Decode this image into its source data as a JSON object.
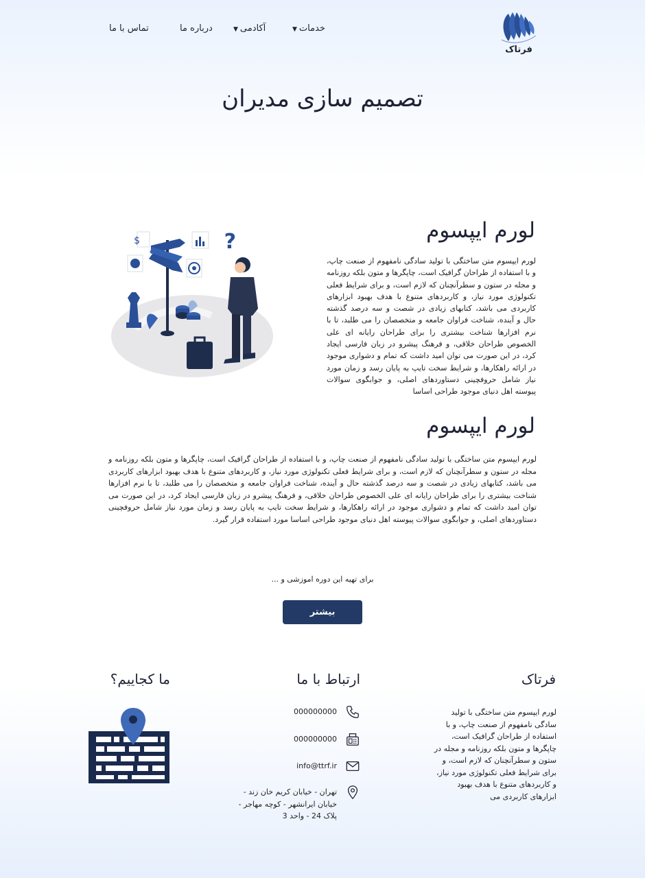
{
  "header": {
    "logo_text": "فرتاک",
    "nav": {
      "services": "خدمات",
      "academy": "آکادمی",
      "about": "درباره ما",
      "contact": "تماس با ما"
    }
  },
  "page_title": "تصمیم سازی مدیران",
  "section1": {
    "title": "لورم ایپسوم",
    "text": "لورم ایپسوم متن ساختگی با تولید سادگی نامفهوم از صنعت چاپ، و با استفاده از طراحان گرافیک است، چاپگرها و متون بلکه روزنامه و مجله در ستون و سطرآنچنان که لازم است، و برای شرایط فعلی تکنولوژی مورد نیاز، و کاربردهای متنوع با هدف بهبود ابزارهای کاربردی می باشد، کتابهای زیادی در شصت و سه درصد گذشته حال و آینده، شناخت فراوان جامعه و متخصصان را می طلبد، تا با نرم افزارها شناخت بیشتری را برای طراحان رایانه ای علی الخصوص طراحان خلاقی، و فرهنگ پیشرو در زبان فارسی ایجاد کرد، در این صورت می توان امید داشت که تمام و دشواری موجود در ارائه راهکارها، و شرایط سخت تایپ به پایان رسد و زمان مورد نیاز شامل حروفچینی دستاوردهای اصلی، و جوابگوی سوالات پیوسته اهل دنیای موجود طراحی اساسا"
  },
  "section2": {
    "title": "لورم ایپسوم",
    "text": "لورم ایپسوم متن ساختگی با تولید سادگی نامفهوم از صنعت چاپ، و با استفاده از طراحان گرافیک است، چاپگرها و متون بلکه روزنامه و مجله در ستون و سطرآنچنان که لازم است، و برای شرایط فعلی تکنولوژی مورد نیاز، و کاربردهای متنوع با هدف بهبود ابزارهای کاربردی می باشد، کتابهای زیادی در شصت و سه درصد گذشته حال و آینده، شناخت فراوان جامعه و متخصصان را می طلبد، تا با نرم افزارها شناخت بیشتری را برای طراحان رایانه ای علی الخصوص طراحان خلاقی، و فرهنگ پیشرو در زبان فارسی ایجاد کرد، در این صورت می توان امید داشت که تمام و دشواری موجود در ارائه راهکارها، و شرایط سخت تایپ به پایان رسد و زمان مورد نیاز شامل حروفچینی دستاوردهای اصلی، و جوابگوی سوالات پیوسته اهل دنیای موجود طراحی اساسا مورد استفاده قرار گیرد."
  },
  "cta": {
    "prompt": "برای تهیه این دوره اموزشی و ...",
    "button_label": "بیشتر",
    "button_color": "#233a66"
  },
  "footer": {
    "brand": {
      "title": "فرتاک",
      "text": "لورم ایپسوم متن ساختگی با تولید سادگی نامفهوم از صنعت چاپ، و با استفاده از طراحان گرافیک است، چاپگرها و متون بلکه روزنامه و مجله در ستون و سطرآنچنان که لازم است، و برای شرایط فعلی تکنولوژی مورد نیاز، و کاربردهای متنوع با هدف بهبود ابزارهای کاربردی می"
    },
    "contact": {
      "title": "ارتباط با ما",
      "phone": "000000000",
      "fax": "000000000",
      "email": "info@ttrf.ir",
      "address": "تهران - خیابان کریم خان زند - خیابان ایرانشهر - کوچه مهاجر - پلاک 24 - واحد 3",
      "icons": [
        "phone-icon",
        "fax-icon",
        "mail-icon",
        "location-pin-icon"
      ]
    },
    "location": {
      "title": "ما کجاییم؟",
      "icon": "map-pin-icon"
    }
  },
  "colors": {
    "primary": "#233a66",
    "text": "#1e2235",
    "logo_blue": "#2a4f96"
  }
}
